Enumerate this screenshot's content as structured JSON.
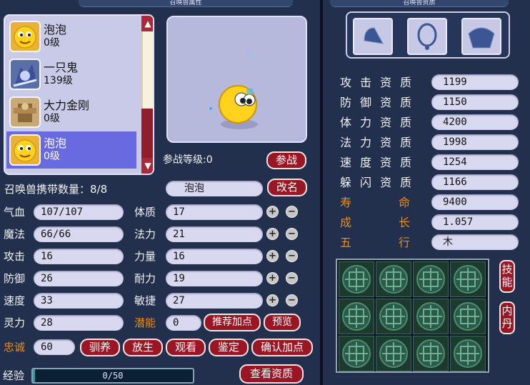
{
  "left_title": "召唤兽属性",
  "right_title": "召唤兽资质",
  "pets": [
    {
      "name": "泡泡",
      "level": "0级",
      "icon": "bubble-pet-icon",
      "selected": false
    },
    {
      "name": "一只鬼",
      "level": "139级",
      "icon": "ghost-pet-icon",
      "selected": false
    },
    {
      "name": "大力金刚",
      "level": "0级",
      "icon": "vajra-pet-icon",
      "selected": false
    },
    {
      "name": "泡泡",
      "level": "0级",
      "icon": "bubble-pet-icon",
      "selected": true
    }
  ],
  "battle_level_label": "参战等级:0",
  "battle_button": "参战",
  "carry_count_label": "召唤兽携带数量：8/8",
  "pet_name_value": "泡泡",
  "rename_button": "改名",
  "stats_left": [
    {
      "label": "气血",
      "value": "107/107"
    },
    {
      "label": "魔法",
      "value": "66/66"
    },
    {
      "label": "攻击",
      "value": "16"
    },
    {
      "label": "防御",
      "value": "26"
    },
    {
      "label": "速度",
      "value": "33"
    },
    {
      "label": "灵力",
      "value": "28"
    }
  ],
  "stats_right": [
    {
      "label": "体质",
      "value": "17"
    },
    {
      "label": "法力",
      "value": "21"
    },
    {
      "label": "力量",
      "value": "16"
    },
    {
      "label": "耐力",
      "value": "19"
    },
    {
      "label": "敏捷",
      "value": "27"
    }
  ],
  "potential_label": "潜能",
  "potential_value": "0",
  "recommend_button": "推荐加点",
  "preview_button": "预览",
  "loyalty_label": "忠诚",
  "loyalty_value": "60",
  "tame_button": "驯养",
  "release_button": "放生",
  "view_button": "观看",
  "appraise_button": "鉴定",
  "confirm_points_button": "确认加点",
  "exp_label": "经验",
  "exp_text": "0/50",
  "exp_progress": 0,
  "view_aptitude_button": "查看资质",
  "aptitudes": [
    {
      "label": "攻击资质",
      "value": "1199",
      "orange": false
    },
    {
      "label": "防御资质",
      "value": "1150",
      "orange": false
    },
    {
      "label": "体力资质",
      "value": "4200",
      "orange": false
    },
    {
      "label": "法力资质",
      "value": "1998",
      "orange": false
    },
    {
      "label": "速度资质",
      "value": "1254",
      "orange": false
    },
    {
      "label": "躲闪资质",
      "value": "1166",
      "orange": false
    },
    {
      "label": "寿命",
      "value": "9400",
      "orange": true
    },
    {
      "label": "成长",
      "value": "1.057",
      "orange": true
    },
    {
      "label": "五行",
      "value": "木",
      "orange": true
    }
  ],
  "equip_slots": [
    "helmet-icon",
    "necklace-icon",
    "armor-icon"
  ],
  "skills_button": "技能",
  "neidan_button": "内丹",
  "colors": {
    "panel": "#22304e",
    "button_red": "#9b1625",
    "field": "#d8d9f0",
    "orange": "#e88d1a"
  }
}
